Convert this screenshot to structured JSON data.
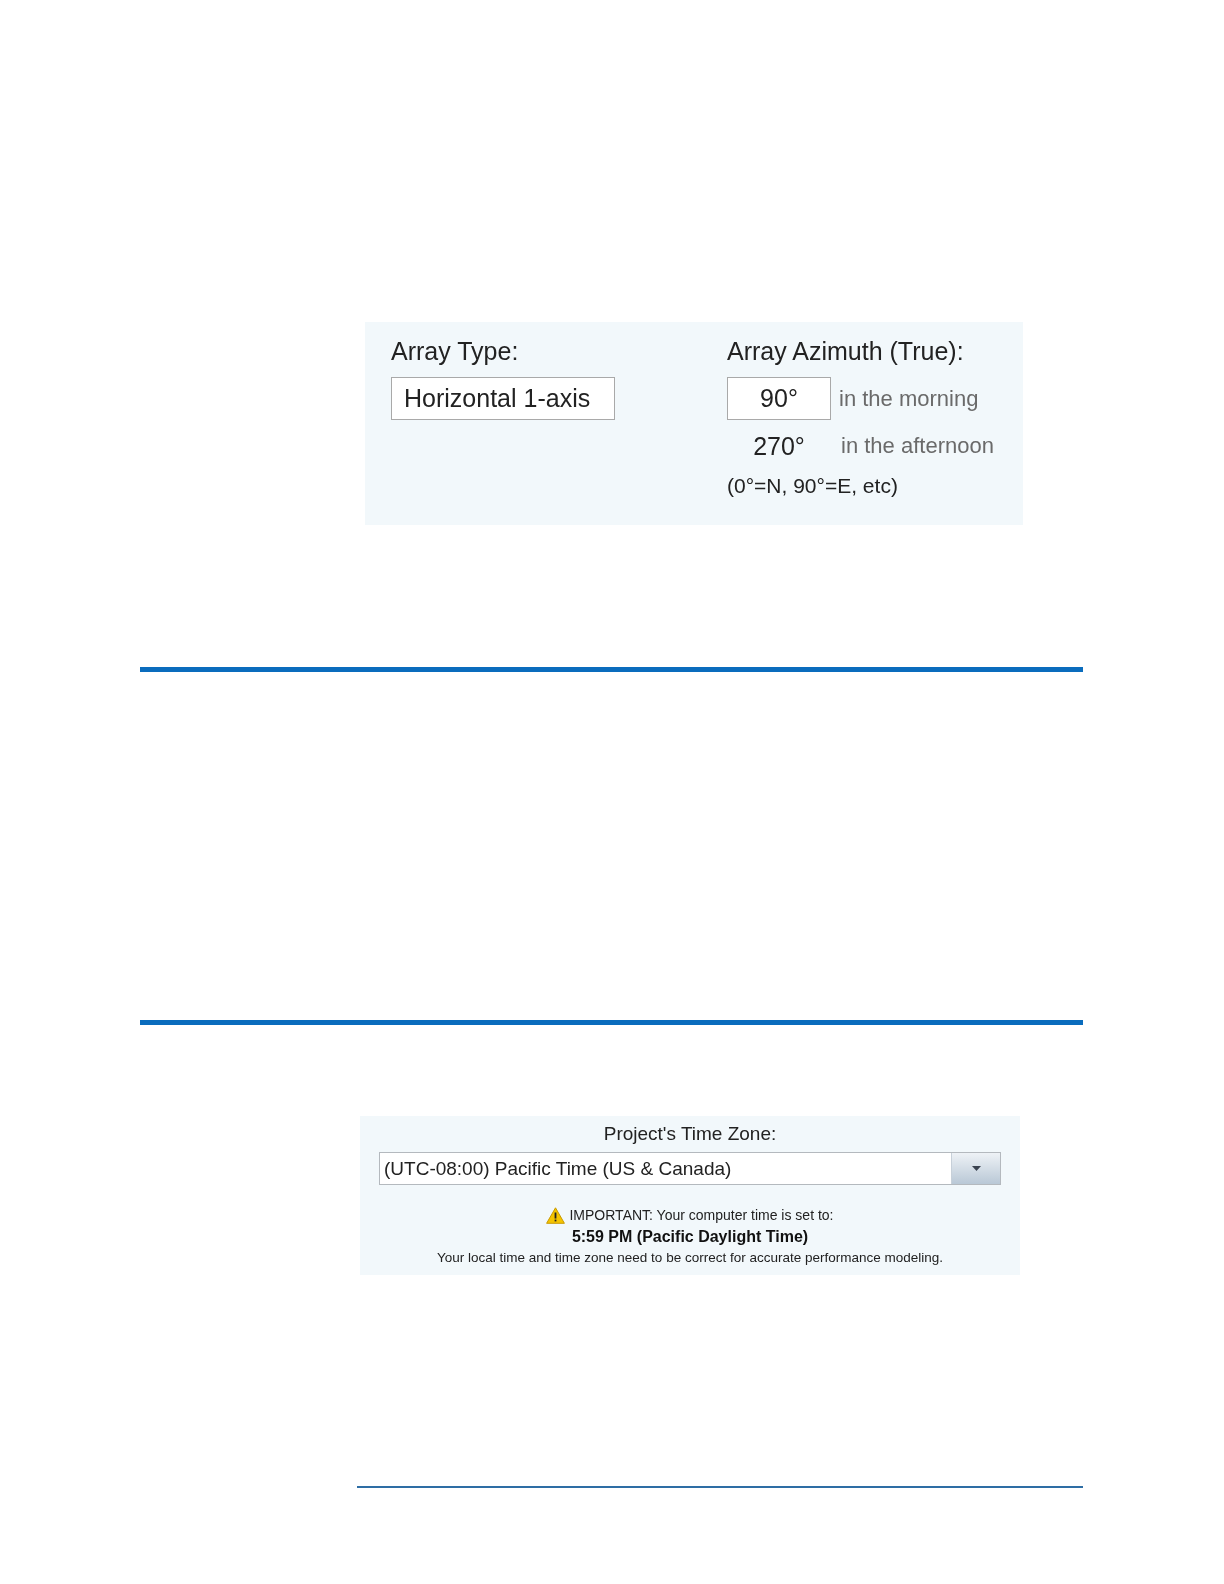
{
  "array_panel": {
    "array_type": {
      "label": "Array Type:",
      "value": "Horizontal 1-axis"
    },
    "azimuth": {
      "label": "Array Azimuth (True):",
      "morning_value": "90°",
      "morning_note": "in the morning",
      "afternoon_value": "270°",
      "afternoon_note": "in the afternoon",
      "hint": "(0°=N, 90°=E, etc)"
    }
  },
  "time_zone_panel": {
    "label": "Project's Time Zone:",
    "dropdown": {
      "value": "(UTC-08:00) Pacific Time (US & Canada)"
    },
    "warning": "IMPORTANT: Your computer time is set to:",
    "current_time": "5:59 PM (Pacific Daylight Time)",
    "note": "Your local time and time zone need to be correct for accurate performance modeling."
  }
}
